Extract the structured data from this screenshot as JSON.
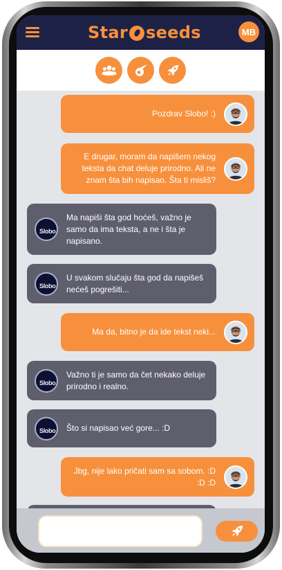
{
  "header": {
    "logo_left": "Star",
    "logo_right": "seeds",
    "user_initials": "MB",
    "menu_icon": "hamburger-menu-icon",
    "brand_color": "#f7903c",
    "bar_color": "#1e2146"
  },
  "tabs": [
    {
      "icon": "users-icon"
    },
    {
      "icon": "comet-icon"
    },
    {
      "icon": "rocket-icon"
    }
  ],
  "messages": [
    {
      "sender": "me",
      "text": "Pozdrav Slobo! :)"
    },
    {
      "sender": "me",
      "text": "E drugar, moram da napišem nekog\nteksta da chat deluje prirodno. Ali ne\nznam šta bih napisao. Šta ti misliš?"
    },
    {
      "sender": "bot",
      "text": "Ma napiši šta god hoćeš, važno je\nsamo da ima teksta, a ne i šta je\nnapisano."
    },
    {
      "sender": "bot",
      "text": "U svakom slučaju šta god da napišeš\nnećeš pogrešiti..."
    },
    {
      "sender": "me",
      "text": "Ma da, bitno je da ide tekst neki..."
    },
    {
      "sender": "bot",
      "text": "Važno ti je samo da čet nekako deluje\nprirodno i realno."
    },
    {
      "sender": "bot",
      "text": "Što si napisao već gore... :D"
    },
    {
      "sender": "me",
      "text": "Jbg, nije lako pričati sam sa sobom. :D\n:D :D"
    }
  ],
  "bot_avatar_text": "Slobo",
  "composer": {
    "value": "",
    "send_icon": "rocket-icon"
  },
  "colors": {
    "my_bubble": "#f7903c",
    "bot_bubble": "#5f5e6d",
    "chat_background": "#e4e5e9"
  }
}
